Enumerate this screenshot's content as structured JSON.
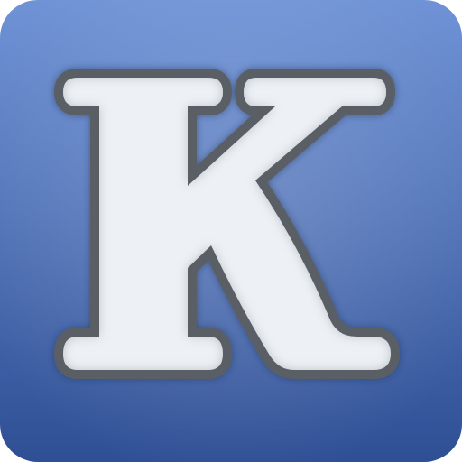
{
  "icon": {
    "letter": "K",
    "name": "k-logo-icon",
    "colors": {
      "background_top": "#6f93d6",
      "background_bottom": "#2f4f95",
      "letter_fill": "#edf1f5",
      "letter_stroke": "#5a5f66",
      "letter_glow": "#9aa4b1"
    }
  }
}
